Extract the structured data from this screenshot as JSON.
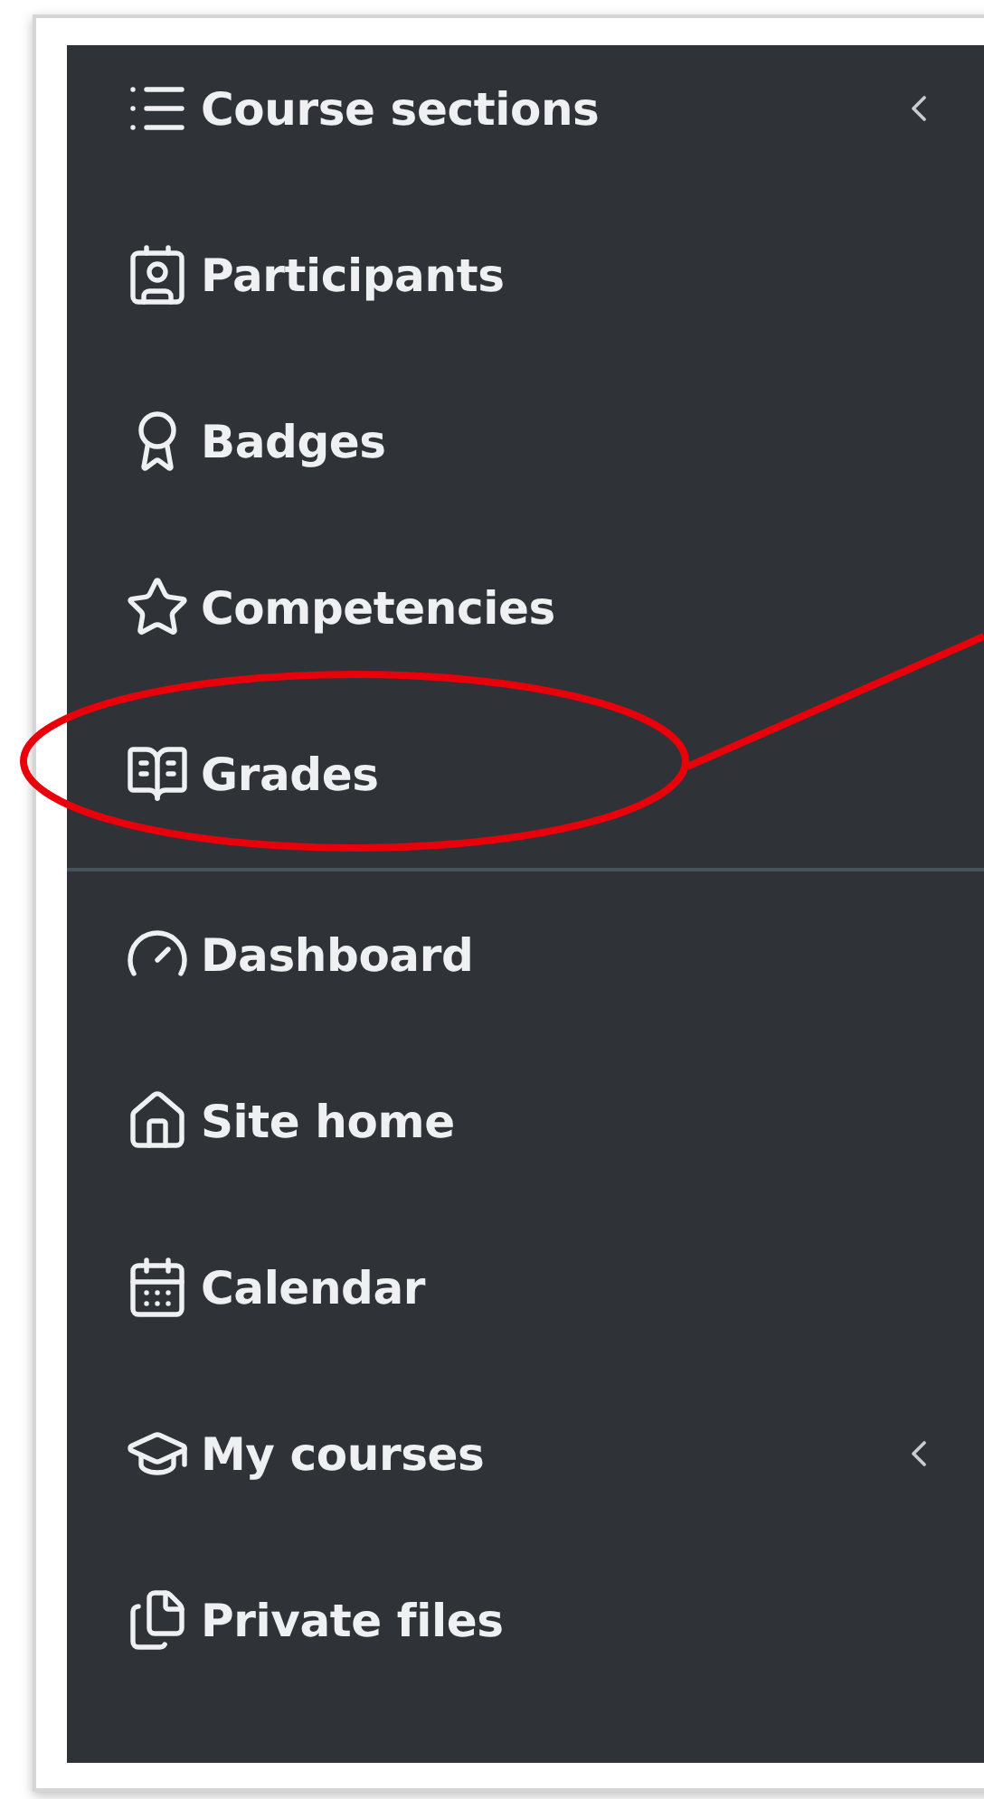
{
  "sections": [
    {
      "items": [
        {
          "label": "Course sections",
          "has_submenu": true
        },
        {
          "label": "Participants",
          "has_submenu": false
        },
        {
          "label": "Badges",
          "has_submenu": false
        },
        {
          "label": "Competencies",
          "has_submenu": false
        },
        {
          "label": "Grades",
          "has_submenu": false
        }
      ]
    },
    {
      "items": [
        {
          "label": "Dashboard",
          "has_submenu": false
        },
        {
          "label": "Site home",
          "has_submenu": false
        },
        {
          "label": "Calendar",
          "has_submenu": false
        },
        {
          "label": "My courses",
          "has_submenu": true
        },
        {
          "label": "Private files",
          "has_submenu": false
        }
      ]
    }
  ]
}
